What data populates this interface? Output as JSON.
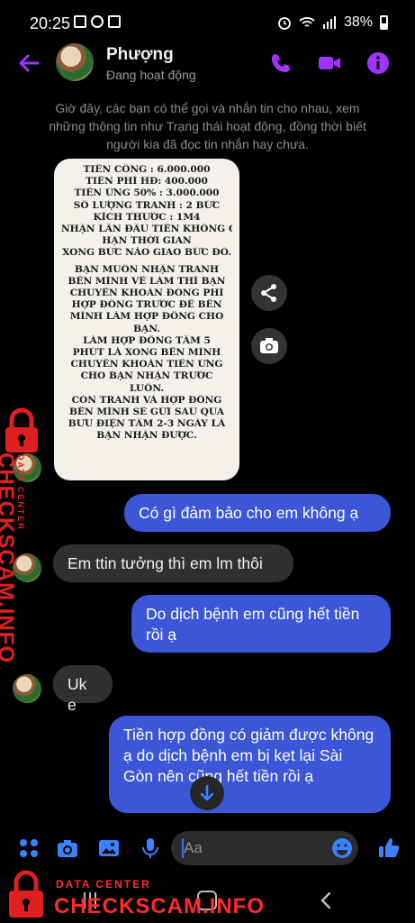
{
  "status_bar": {
    "time": "20:25",
    "battery": "38%"
  },
  "header": {
    "contact_name": "Phượng",
    "contact_status": "Đang hoạt động",
    "colors": {
      "accent": "#a033ff"
    }
  },
  "notice": "Giờ đây, các bạn có thể gọi và nhắn tin cho nhau, xem những thông tin như Trạng thái hoạt động, đồng thời biết người kia đã đọc tin nhắn hay chưa.",
  "image_message": {
    "lines_top": [
      "TIỀN CÔNG : 6.000.000",
      "TIỀN PHÍ HĐ: 400.000",
      "TIỀN ỨNG 50% : 3.000.000",
      "SỐ LƯỢNG TRANH : 2 BỨC",
      "KÍCH THƯỚC : 1M4",
      "NHẬN LẦN ĐẦU TIÊN KHÔNG GIA",
      "HẠN THỜI GIAN",
      "XONG BỨC NÀO GIAO BỨC ĐÓ."
    ],
    "lines_bottom": [
      "BẠN MUỐN NHẬN TRANH",
      "BÊN MÌNH VỀ LÀM THÌ BẠN",
      "CHUYỂN KHOẢN ĐÓNG PHÍ",
      "HỢP ĐỒNG TRƯỚC ĐỂ BÊN",
      "MÌNH LÀM HỢP ĐỒNG CHO",
      "BẠN.",
      "LÀM HỢP ĐỒNG TẦM 5",
      "PHÚT LÀ XONG BÊN MÌNH",
      "CHUYỂN KHOẢN TIỀN ỨNG",
      "CHO BẠN NHẬN TRƯỚC",
      "LUÔN.",
      "CÒN TRANH VÀ HỢP ĐỒNG",
      "BÊN MÌNH SẼ GỬI SAU QUA",
      "BƯU ĐIỆN TẦM 2-3 NGÀY LÀ",
      "BẠN NHẬN ĐƯỢC."
    ]
  },
  "messages": [
    {
      "dir": "out",
      "text": "Có gì đảm bảo cho em không ạ"
    },
    {
      "dir": "in",
      "text": "Em ttin tưởng thì em lm thôi"
    },
    {
      "dir": "out",
      "text": "Do dịch bệnh em cũng hết tiền rồi ạ"
    },
    {
      "dir": "in",
      "text": "Uk e"
    },
    {
      "dir": "out",
      "text": "Tiền hợp đồng có giảm được không ạ do dịch bệnh em bị kẹt lại Sài Gòn nên cũng hết tiền rồi ạ"
    }
  ],
  "composer": {
    "placeholder": "Aa"
  },
  "watermark": {
    "data_center": "DATA CENTER",
    "brand": "CHECKSCAM.INFO",
    "color": "#e02020"
  },
  "icons": [
    "back-icon",
    "phone-icon",
    "video-icon",
    "info-icon",
    "share-icon",
    "camera-icon",
    "grid-icon",
    "gallery-icon",
    "mic-icon",
    "emoji-icon",
    "like-icon",
    "lock-icon",
    "chevron-down-icon"
  ]
}
